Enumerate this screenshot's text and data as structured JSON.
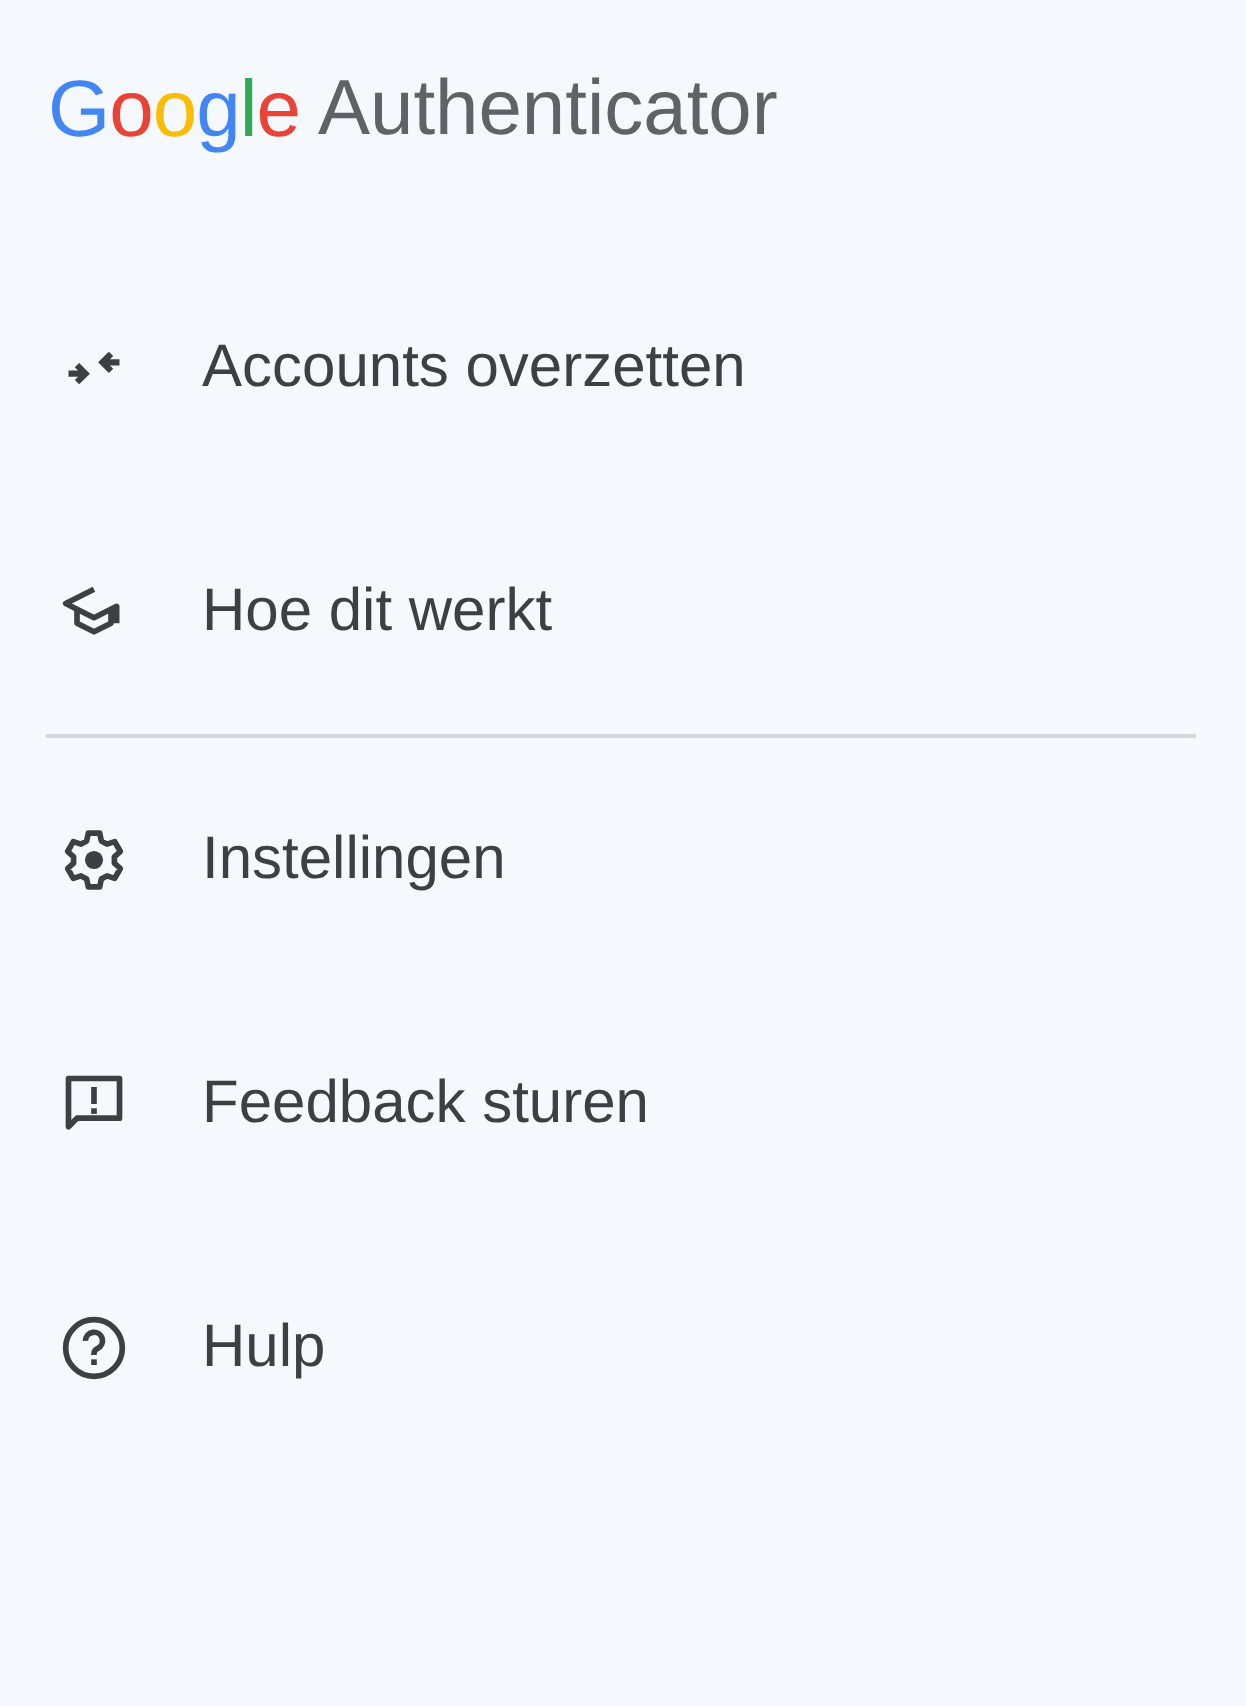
{
  "header": {
    "brand": "Google",
    "product": "Authenticator"
  },
  "menu_sections": [
    {
      "items": [
        {
          "kind": "transfer",
          "label": "Accounts overzetten"
        },
        {
          "kind": "learn",
          "label": "Hoe dit werkt"
        }
      ]
    },
    {
      "items": [
        {
          "kind": "settings",
          "label": "Instellingen"
        },
        {
          "kind": "feedback",
          "label": "Feedback sturen"
        },
        {
          "kind": "help",
          "label": "Hulp"
        }
      ]
    }
  ]
}
